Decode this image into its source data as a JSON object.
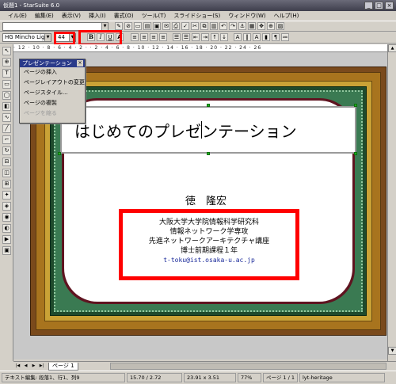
{
  "window": {
    "title": "仮題1 - StarSuite 6.0"
  },
  "menubar": {
    "items": [
      "イル(E)",
      "編集(E)",
      "表示(V)",
      "挿入(I)",
      "書式(O)",
      "ツール(T)",
      "スライドショー(S)",
      "ウィンドウ(W)",
      "ヘルプ(H)"
    ]
  },
  "formatting": {
    "font_name": "HG Mincho Light",
    "font_size": "44",
    "bold": "B",
    "italic": "I",
    "underline": "U",
    "shadow": "A"
  },
  "ruler": {
    "marks": "· 12 · 10 · 8 · 6 · 4 · 2 · · 2 · 4 · 6 · 8 · 10 · 12 · 14 · 16 · 18 · 20 · 22 · 24 · 26"
  },
  "presentation_panel": {
    "title": "プレゼンテーション",
    "items": [
      {
        "label": "ページの挿入",
        "enabled": true
      },
      {
        "label": "ページレイアウトの変更",
        "enabled": true
      },
      {
        "label": "ページスタイル...",
        "enabled": true
      },
      {
        "label": "ページの複製",
        "enabled": true
      },
      {
        "label": "ページを縮る",
        "enabled": false
      }
    ]
  },
  "slide": {
    "title": "はじめてのプレゼンテーション",
    "title_before_cursor": "はじめてのプレゼ",
    "title_after_cursor": "ンテーション",
    "author": "徳　隆宏",
    "info_lines": [
      "大阪大学大学院情報科学研究科",
      "情報ネットワーク学専攻",
      "先進ネットワークアーキテクチャ講座",
      "博士前期課程１年"
    ],
    "email": "t-toku@ist.osaka-u.ac.jp"
  },
  "tabbar": {
    "tab_label": "ページ 1"
  },
  "status": {
    "mode": "テキスト編集: 段落1、行1、列9",
    "position": "15.70 / 2.72",
    "size": "23.91 x 3.51",
    "zoom": "77%",
    "page": "ページ 1 / 1",
    "template": "lyt-heritage"
  }
}
